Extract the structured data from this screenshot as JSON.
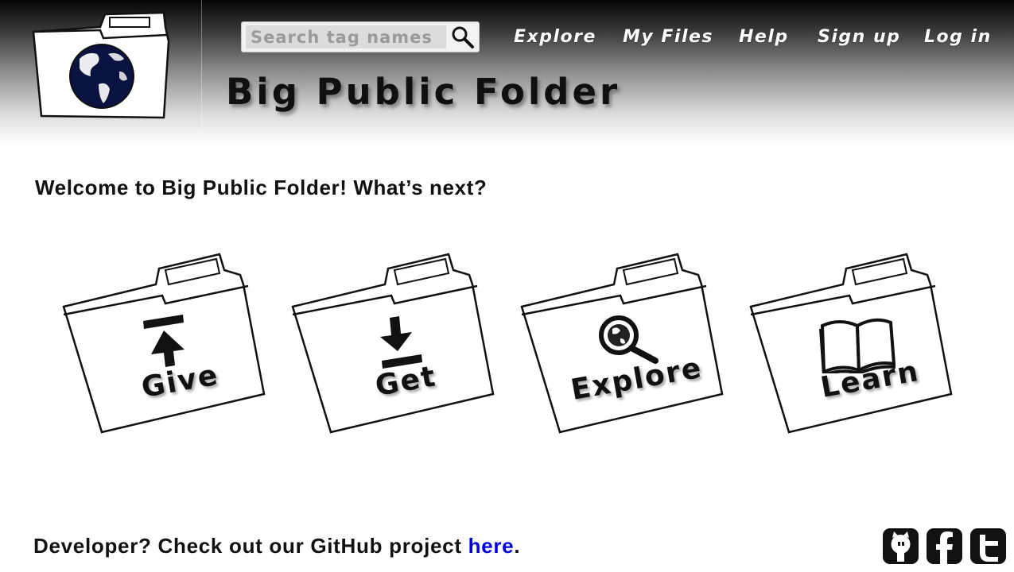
{
  "header": {
    "site_title": "Big Public Folder",
    "search": {
      "placeholder": "Search tag names",
      "value": ""
    },
    "nav": [
      {
        "label": "Explore"
      },
      {
        "label": "My Files"
      },
      {
        "label": "Help"
      },
      {
        "label": "Sign up"
      },
      {
        "label": "Log in"
      }
    ]
  },
  "main": {
    "welcome": "Welcome to Big Public Folder! What’s next?",
    "tiles": [
      {
        "label": "Give",
        "icon": "upload-icon"
      },
      {
        "label": "Get",
        "icon": "download-icon"
      },
      {
        "label": "Explore",
        "icon": "magnifier-globe-icon"
      },
      {
        "label": "Learn",
        "icon": "open-book-icon"
      }
    ]
  },
  "footer": {
    "text": "Developer? Check out our GitHub project ",
    "link_text": "here",
    "suffix": ".",
    "social": [
      "github-icon",
      "facebook-icon",
      "twitter-icon"
    ]
  },
  "colors": {
    "link": "#0000dd",
    "header_top": "#050505"
  }
}
